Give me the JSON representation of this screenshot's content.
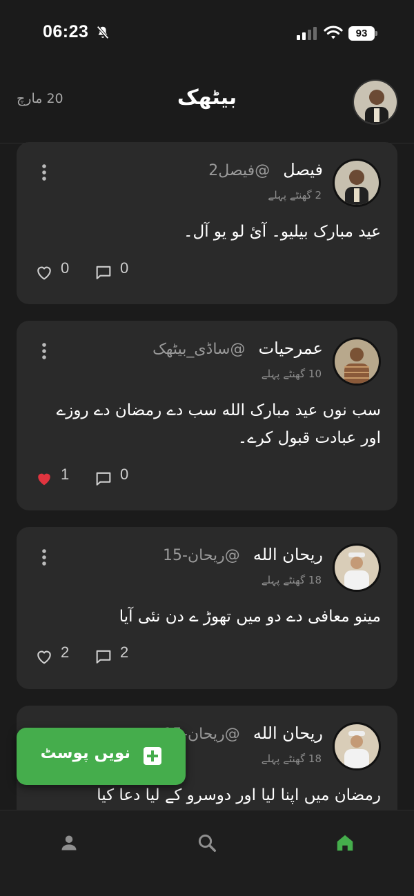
{
  "status_bar": {
    "time": "06:23",
    "battery": "93"
  },
  "header": {
    "title": "بیٹھک",
    "date": "20 مارچ"
  },
  "posts": [
    {
      "name": "فیصل",
      "handle": "@فیصل2",
      "time": "2 گھنٹے پہلے",
      "text": "عید مبارک بیلیو۔ آئ لو یو آل۔",
      "likes": "0",
      "comments": "0",
      "liked": false
    },
    {
      "name": "عمرحیات",
      "handle": "@ساڈی_بیٹھک",
      "time": "10 گھنٹے پہلے",
      "text": "سب نوں عید مبارک الله سب دے رمضان دے روزے اور عبادت قبول کرے۔",
      "likes": "1",
      "comments": "0",
      "liked": true
    },
    {
      "name": "ریحان الله",
      "handle": "@ریحان-15",
      "time": "18 گھنٹے پہلے",
      "text": "مینو معافی دے دو میں تھوڑ ے دن نئی آیا",
      "likes": "2",
      "comments": "2",
      "liked": false
    },
    {
      "name": "ریحان الله",
      "handle": "@ریحان-15",
      "time": "18 گھنٹے پہلے",
      "text": "رمضان میں اپنا لیا اور دوسرو کے لیا دعا کیا",
      "likes": "",
      "comments": "",
      "liked": false
    }
  ],
  "new_post_button": {
    "label": "نویں پوسٹ"
  },
  "colors": {
    "accent": "#45ad4c",
    "like_active": "#e0343f",
    "card": "#2a2a2a",
    "background": "#1b1b1b"
  },
  "nav": {
    "items": [
      "profile-icon",
      "search-icon",
      "home-icon"
    ],
    "active": "home-icon"
  }
}
